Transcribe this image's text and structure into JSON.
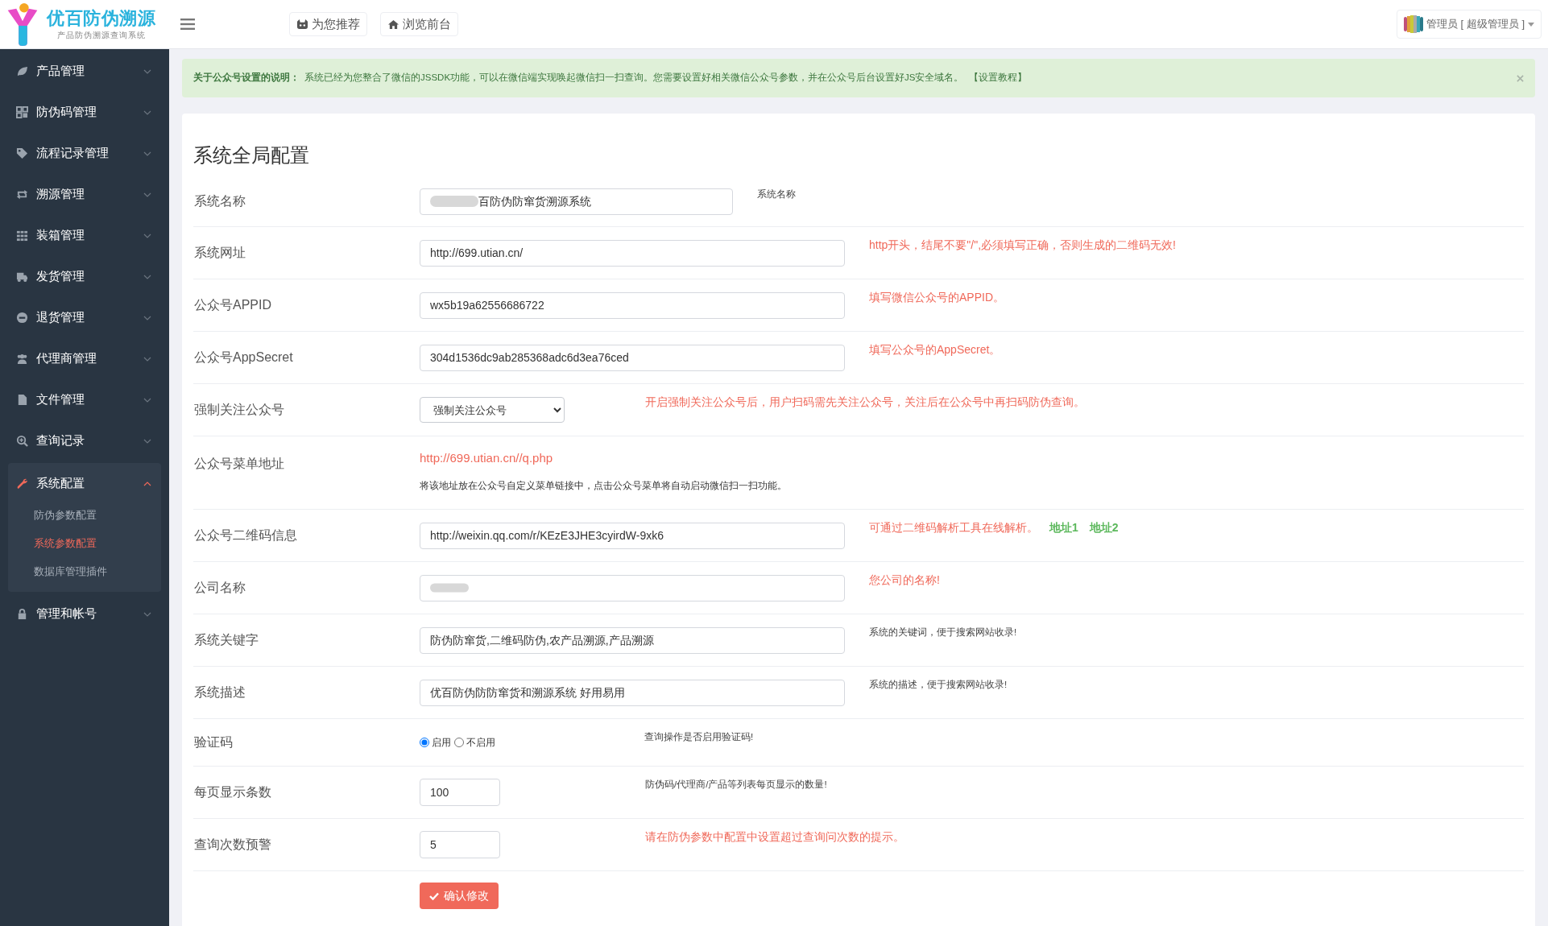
{
  "header": {
    "logo_title": "优百防伪溯源",
    "logo_subtitle": "产品防伪溯源查询系统",
    "top_buttons": [
      "为您推荐",
      "浏览前台"
    ],
    "user": "管理员 [ 超级管理员 ]"
  },
  "sidebar": {
    "items": [
      {
        "label": "产品管理",
        "expanded": false
      },
      {
        "label": "防伪码管理",
        "expanded": false
      },
      {
        "label": "流程记录管理",
        "expanded": false
      },
      {
        "label": "溯源管理",
        "expanded": false
      },
      {
        "label": "装箱管理",
        "expanded": false
      },
      {
        "label": "发货管理",
        "expanded": false
      },
      {
        "label": "退货管理",
        "expanded": false
      },
      {
        "label": "代理商管理",
        "expanded": false
      },
      {
        "label": "文件管理",
        "expanded": false
      },
      {
        "label": "查询记录",
        "expanded": false
      },
      {
        "label": "系统配置",
        "expanded": true,
        "children": [
          {
            "label": "防伪参数配置",
            "selected": false
          },
          {
            "label": "系统参数配置",
            "selected": true
          },
          {
            "label": "数据库管理插件",
            "selected": false
          }
        ]
      },
      {
        "label": "管理和帐号",
        "expanded": false
      }
    ]
  },
  "notice": {
    "title": "关于公众号设置的说明：",
    "text": "系统已经为您整合了微信的JSSDK功能，可以在微信端实现唤起微信扫一扫查询。您需要设置好相关微信公众号参数，并在公众号后台设置好JS安全域名。",
    "link": "【设置教程】"
  },
  "form": {
    "title": "系统全局配置",
    "rows": [
      {
        "kind": "short-text",
        "label": "系统名称",
        "value": "百防伪防窜货溯源系统",
        "redacted": true,
        "hint": {
          "text": "系统名称",
          "emphasized": false
        }
      },
      {
        "kind": "text",
        "label": "系统网址",
        "value": "http://699.utian.cn/",
        "hint": {
          "text": "http开头，结尾不要\"/\",必须填写正确，否则生成的二维码无效!",
          "emphasized": true
        }
      },
      {
        "kind": "text",
        "label": "公众号APPID",
        "value": "wx5b19a62556686722",
        "hint": {
          "text": "填写微信公众号的APPID。",
          "emphasized": true
        }
      },
      {
        "kind": "text",
        "label": "公众号AppSecret",
        "value": "304d1536dc9ab285368adc6d3ea76ced",
        "hint": {
          "text": "填写公众号的AppSecret。",
          "emphasized": true
        }
      },
      {
        "kind": "select",
        "label": "强制关注公众号",
        "value": "强制关注公众号",
        "hint": {
          "text": "开启强制关注公众号后，用户扫码需先关注公众号，关注后在公众号中再扫码防伪查询。",
          "emphasized": true
        }
      },
      {
        "kind": "link",
        "label": "公众号菜单地址",
        "value": "http://699.utian.cn//q.php",
        "description": "将该地址放在公众号自定义菜单链接中，点击公众号菜单将自动启动微信扫一扫功能。"
      },
      {
        "kind": "text",
        "label": "公众号二维码信息",
        "value": "http://weixin.qq.com/r/KEzE3JHE3cyirdW-9xk6",
        "hint": {
          "text": "可通过二维码解析工具在线解析。",
          "emphasized": true,
          "links": [
            "地址1",
            "地址2"
          ]
        }
      },
      {
        "kind": "text",
        "label": "公司名称",
        "redacted": true,
        "hint": {
          "text": "您公司的名称!",
          "emphasized": true
        }
      },
      {
        "kind": "text",
        "label": "系统关键字",
        "value": "防伪防窜货,二维码防伪,农产品溯源,产品溯源",
        "hint": {
          "text": "系统的关键词，便于搜索网站收录!",
          "emphasized": false
        }
      },
      {
        "kind": "text",
        "label": "系统描述",
        "value": "优百防伪防防窜货和溯源系统 好用易用",
        "hint": {
          "text": "系统的描述，便于搜索网站收录!",
          "emphasized": false
        }
      },
      {
        "kind": "radio",
        "label": "验证码",
        "options": [
          {
            "label": "启用",
            "selected": true
          },
          {
            "label": "不启用",
            "selected": false
          }
        ],
        "hint": {
          "text": "查询操作是否启用验证码!",
          "emphasized": false
        }
      },
      {
        "kind": "number",
        "label": "每页显示条数",
        "value": "100",
        "hint": {
          "text": "防伪码/代理商/产品等列表每页显示的数量!",
          "emphasized": false
        }
      },
      {
        "kind": "number",
        "label": "查询次数预警",
        "value": "5",
        "hint": {
          "text": "请在防伪参数中配置中设置超过查询问次数的提示。",
          "emphasized": true
        }
      }
    ],
    "submit": "确认修改"
  }
}
